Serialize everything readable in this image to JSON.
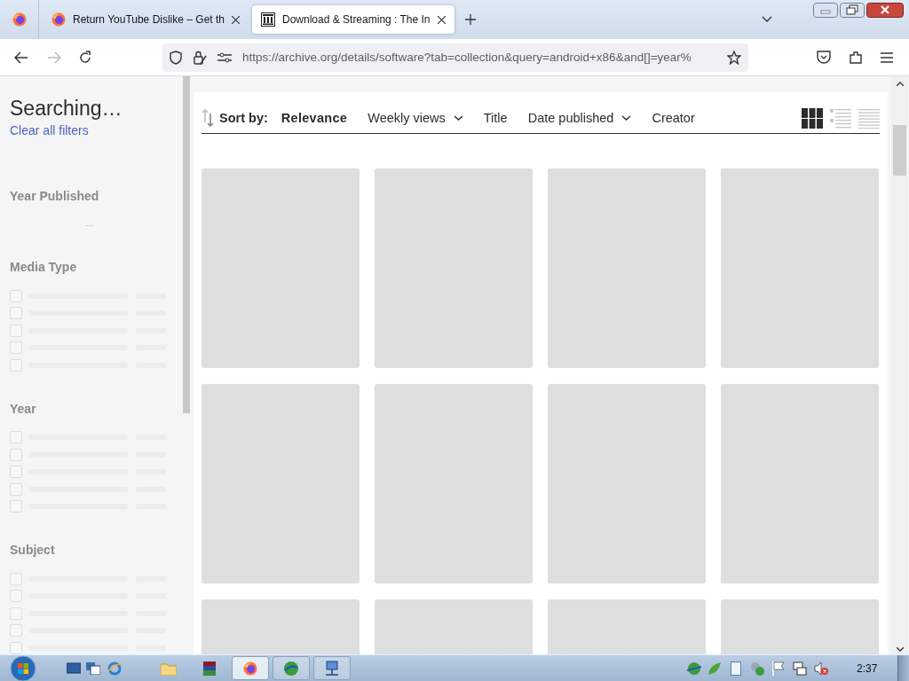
{
  "browser": {
    "tabs": [
      {
        "title": "Return YouTube Dislike – Get th",
        "kind": "firefox",
        "selected": false
      },
      {
        "title": "Download & Streaming : The In",
        "kind": "archive",
        "selected": true
      }
    ],
    "url": "https://archive.org/details/software?tab=collection&query=android+x86&and[]=year%"
  },
  "sidebar": {
    "title": "Searching…",
    "clear_link": "Clear all filters",
    "facets": [
      {
        "title": "Year Published",
        "kind": "histogram"
      },
      {
        "title": "Media Type",
        "kind": "list",
        "rows": [
          {
            "checked": false
          },
          {
            "checked": false
          },
          {
            "checked": false
          },
          {
            "checked": false
          },
          {
            "checked": false
          }
        ]
      },
      {
        "title": "Year",
        "kind": "list",
        "rows": [
          {
            "checked": false
          },
          {
            "checked": false
          },
          {
            "checked": false
          },
          {
            "checked": false
          },
          {
            "checked": false
          }
        ]
      },
      {
        "title": "Subject",
        "kind": "list",
        "rows": [
          {
            "checked": false
          },
          {
            "checked": false
          },
          {
            "checked": false
          },
          {
            "checked": false
          },
          {
            "checked": false
          }
        ]
      }
    ]
  },
  "sort_bar": {
    "label": "Sort by:",
    "options": [
      {
        "label": "Relevance",
        "selected": true,
        "dropdown": false
      },
      {
        "label": "Weekly views",
        "selected": false,
        "dropdown": true
      },
      {
        "label": "Title",
        "selected": false,
        "dropdown": false
      },
      {
        "label": "Date published",
        "selected": false,
        "dropdown": true
      },
      {
        "label": "Creator",
        "selected": false,
        "dropdown": false
      }
    ],
    "view_modes": [
      {
        "kind": "grid",
        "selected": true
      },
      {
        "kind": "list",
        "selected": false
      },
      {
        "kind": "compact",
        "selected": false
      }
    ]
  },
  "results": [
    {
      "loading": true
    },
    {
      "loading": true
    },
    {
      "loading": true
    },
    {
      "loading": true
    },
    {
      "loading": true
    },
    {
      "loading": true
    },
    {
      "loading": true
    },
    {
      "loading": true
    },
    {
      "loading": true
    },
    {
      "loading": true
    },
    {
      "loading": true
    },
    {
      "loading": true
    }
  ],
  "taskbar": {
    "windows": [
      {
        "kind": "firefox",
        "selected": true
      },
      {
        "kind": "globe",
        "selected": false
      },
      {
        "kind": "network",
        "selected": false
      }
    ],
    "clock": "2:37"
  }
}
